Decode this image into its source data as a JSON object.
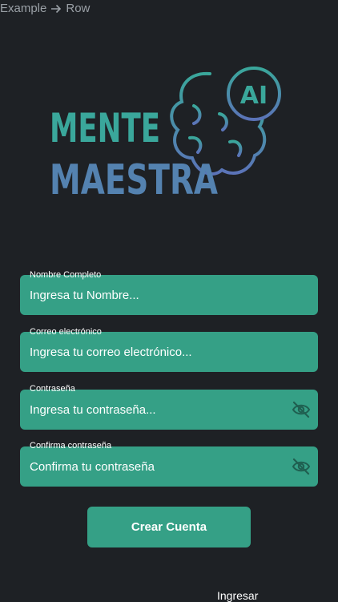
{
  "breadcrumb": {
    "from": "Example",
    "to": "Row",
    "arrow_icon": "arrow-right-icon"
  },
  "logo": {
    "line1": "MENTE",
    "line2": "MAESTRA",
    "badge": "AI",
    "icon": "brain-icon",
    "colors": {
      "top": "#3aa79b",
      "bottom": "#5b73b8"
    }
  },
  "form": {
    "name": {
      "label": "Nombre Completo",
      "placeholder": "Ingresa tu Nombre..."
    },
    "email": {
      "label": "Correo electrónico",
      "placeholder": "Ingresa tu correo electrónico..."
    },
    "password": {
      "label": "Contraseña",
      "placeholder": "Ingresa tu contraseña...",
      "icon": "eye-off-icon"
    },
    "confirm": {
      "label": "Confirma contraseña",
      "placeholder": "Confirma tu contraseña",
      "icon": "eye-off-icon"
    },
    "submit_label": "Crear Cuenta",
    "login_label": "Ingresar"
  },
  "colors": {
    "background": "#1e2125",
    "field": "#35a086",
    "text": "#ffffff",
    "icon": "#1f5f50"
  }
}
